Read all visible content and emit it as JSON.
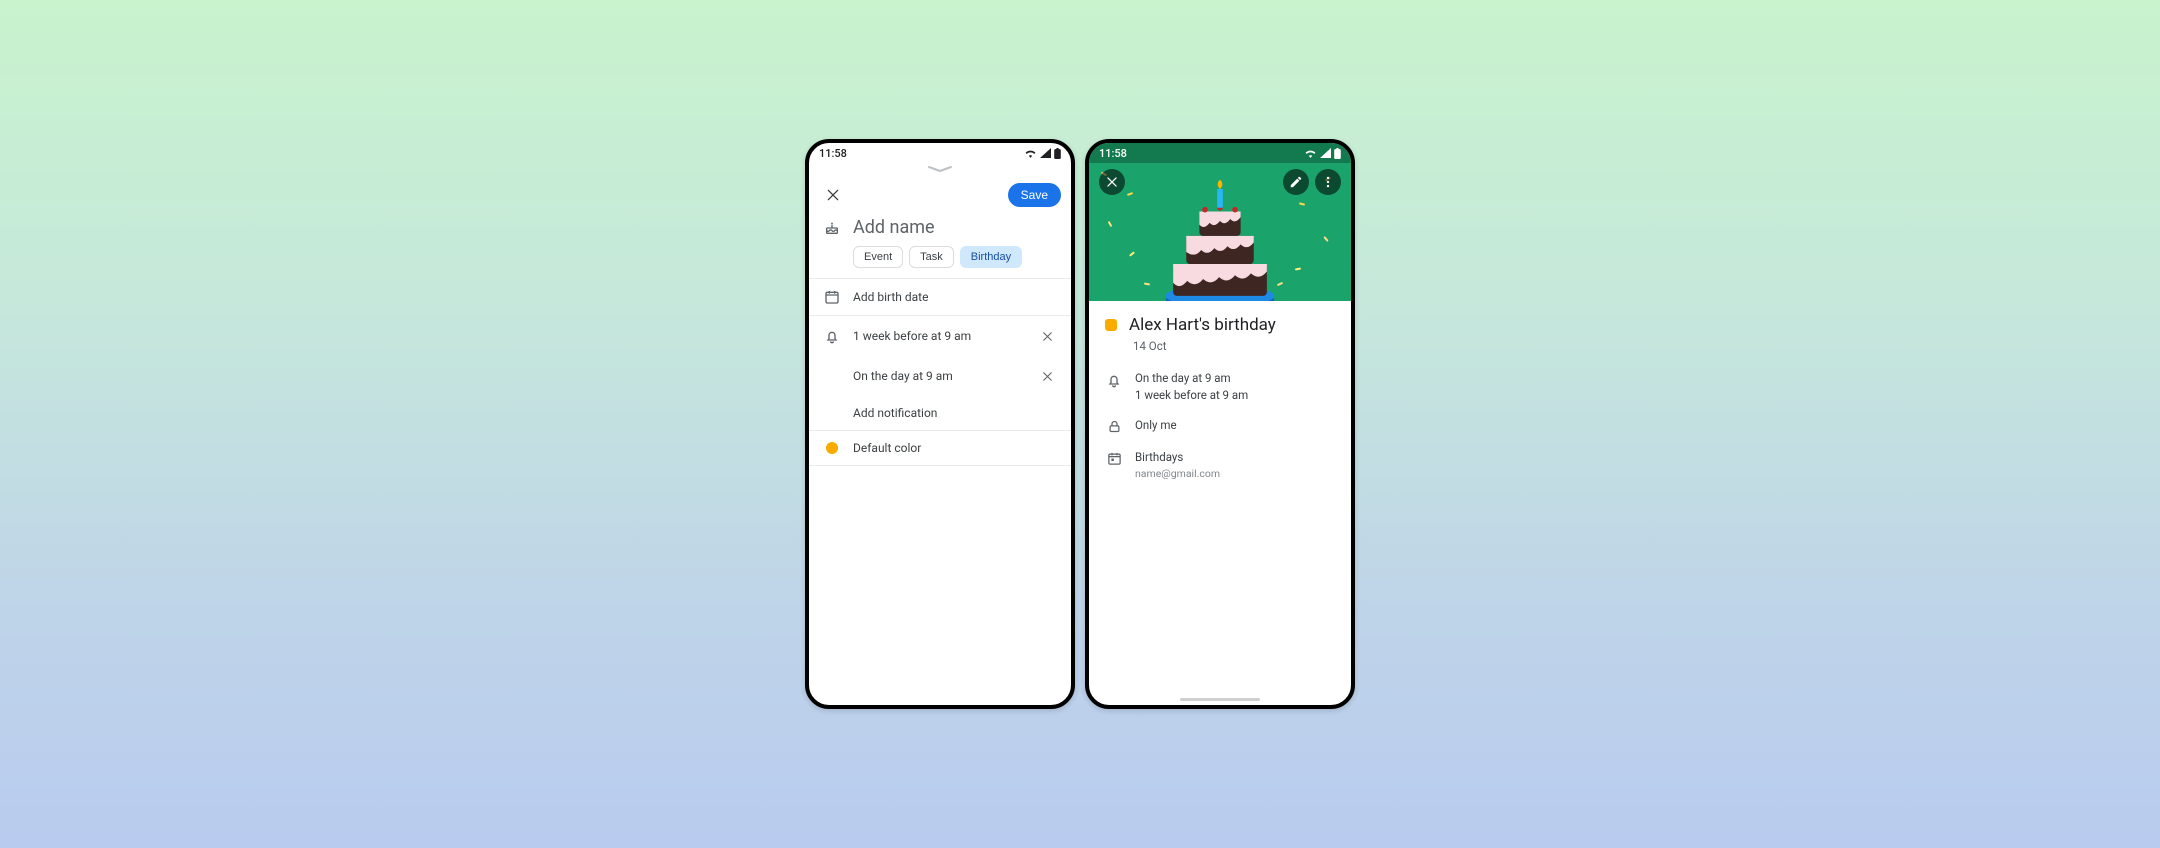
{
  "status": {
    "time": "11:58"
  },
  "edit": {
    "save_label": "Save",
    "title_placeholder": "Add name",
    "chips": {
      "event": "Event",
      "task": "Task",
      "birthday": "Birthday"
    },
    "birth_date_label": "Add birth date",
    "notifications": {
      "n1": "1 week before at 9 am",
      "n2": "On the day at 9 am",
      "add": "Add notification"
    },
    "color_label": "Default color",
    "color_hex": "#f9ab00"
  },
  "view": {
    "title": "Alex Hart's birthday",
    "date": "14 Oct",
    "reminders": {
      "r1": "On the day at 9 am",
      "r2": "1 week before at 9 am"
    },
    "visibility": "Only me",
    "calendar_name": "Birthdays",
    "calendar_email": "name@gmail.com",
    "header_bg": "#1aa36a"
  }
}
